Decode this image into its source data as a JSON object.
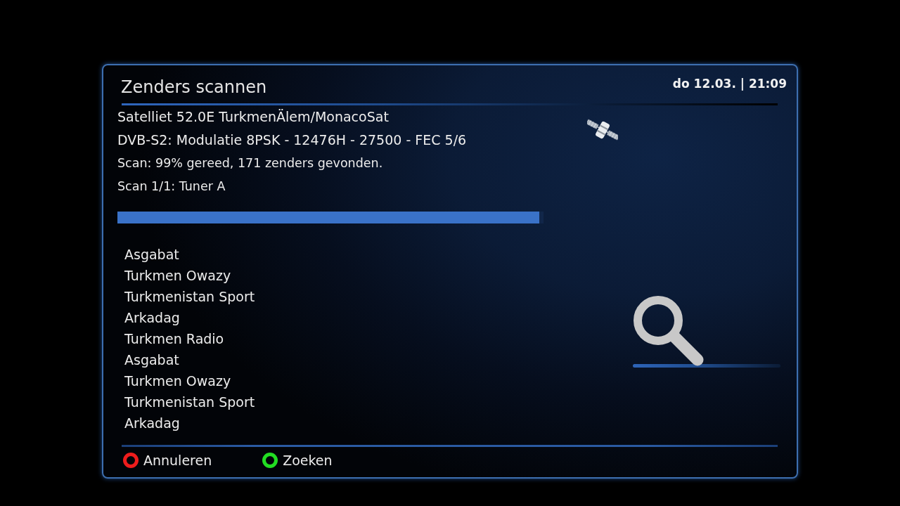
{
  "dialog": {
    "title": "Zenders scannen",
    "datetime": "do 12.03. | 21:09"
  },
  "scan_info": [
    {
      "text": "Satelliet 52.0E TurkmenÄlem/MonacoSat",
      "kind": "primary"
    },
    {
      "text": "DVB-S2: Modulatie 8PSK - 12476H - 27500 - FEC 5/6",
      "kind": "primary"
    },
    {
      "text": "Scan: 99% gereed, 171 zenders gevonden.",
      "kind": "secondary"
    },
    {
      "text": "Scan 1/1: Tuner A",
      "kind": "secondary"
    }
  ],
  "progress": {
    "level": 0.99
  },
  "channels": [
    "Asgabat",
    "Turkmen Owazy",
    "Turkmenistan Sport",
    "Arkadag",
    "Turkmen Radio",
    "Asgabat",
    "Turkmen Owazy",
    "Turkmenistan Sport",
    "Arkadag"
  ],
  "buttons": [
    {
      "label": "Annuleren",
      "color": "#ee1c1c"
    },
    {
      "label": "Zoeken",
      "color": "#22dd22"
    }
  ]
}
